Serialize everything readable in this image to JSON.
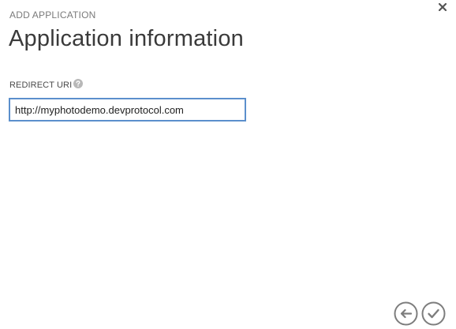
{
  "dialog": {
    "breadcrumb": "ADD APPLICATION",
    "title": "Application information",
    "close_icon": "close-icon"
  },
  "form": {
    "redirect_uri": {
      "label": "REDIRECT URI",
      "help_icon": "question-mark-icon",
      "value": "http://myphotodemo.devprotocol.com"
    }
  },
  "footer": {
    "back_icon": "arrow-left-icon",
    "confirm_icon": "checkmark-icon"
  },
  "colors": {
    "input_border": "#5b8fcc",
    "icon_gray": "#7d7d7d",
    "title_text": "#3a3a3a"
  }
}
